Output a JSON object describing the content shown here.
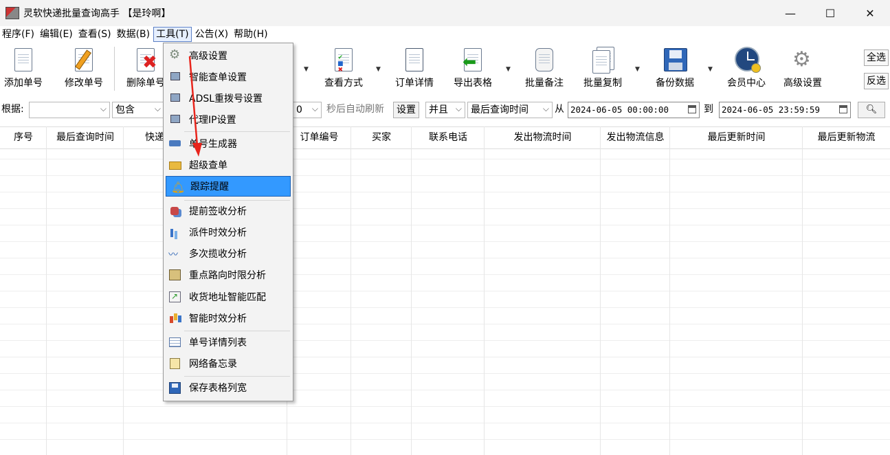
{
  "window": {
    "title": "灵软快递批量查询高手 【是玲啊】",
    "minimize": "—",
    "maximize": "☐",
    "close": "✕"
  },
  "menubar": [
    "程序(F)",
    "编辑(E)",
    "查看(S)",
    "数据(B)",
    "工具(T)",
    "公告(X)",
    "帮助(H)"
  ],
  "toolbar": {
    "add": "添加单号",
    "edit": "修改单号",
    "delete": "删除单号",
    "view_mode": "查看方式",
    "order_detail": "订单详情",
    "export": "导出表格",
    "batch_note": "批量备注",
    "batch_copy": "批量复制",
    "backup": "备份数据",
    "member": "会员中心",
    "advanced": "高级设置",
    "select_all": "全选",
    "invert": "反选"
  },
  "filter": {
    "basis_label": "根据:",
    "contains": "包含",
    "refresh_value": "0",
    "refresh_label": "秒后自动刷新",
    "settings": "设置",
    "and": "并且",
    "field": "最后查询时间",
    "from": "从",
    "from_date": "2024-06-05 00:00:00",
    "to": "到",
    "to_date": "2024-06-05 23:59:59"
  },
  "grid": {
    "columns": [
      "序号",
      "最后查询时间",
      "快递",
      "订单编号",
      "买家",
      "联系电话",
      "发出物流时间",
      "发出物流信息",
      "最后更新时间",
      "最后更新物流"
    ]
  },
  "tools_menu": {
    "items": [
      "高级设置",
      "智能查单设置",
      "ADSL重拨号设置",
      "代理IP设置",
      "单号生成器",
      "超级查单",
      "跟踪提醒",
      "提前签收分析",
      "派件时效分析",
      "多次揽收分析",
      "重点路向时限分析",
      "收货地址智能匹配",
      "智能时效分析",
      "单号详情列表",
      "网络备忘录",
      "保存表格列宽"
    ],
    "highlighted": "跟踪提醒"
  },
  "colors": {
    "highlight": "#3399ff",
    "arrow": "#e8251c"
  }
}
